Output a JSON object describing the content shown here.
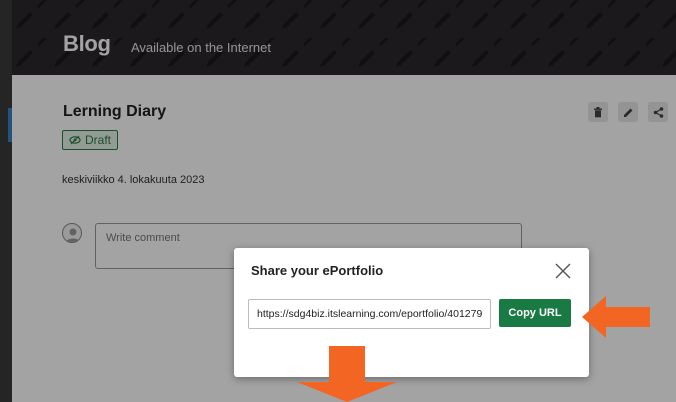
{
  "header": {
    "title": "Blog",
    "subtitle": "Available on the Internet"
  },
  "post": {
    "title": "Lerning Diary",
    "status": "Draft",
    "date": "keskiviikko 4. lokakuuta 2023"
  },
  "toolbar": {
    "icons": [
      "trash-icon",
      "pencil-icon",
      "share-icon"
    ]
  },
  "comment": {
    "placeholder": "Write comment"
  },
  "modal": {
    "title": "Share your ePortfolio",
    "url": "https://sdg4biz.itslearning.com/eportfolio/401279",
    "copy_label": "Copy URL"
  },
  "colors": {
    "header_bg": "#2c282d",
    "accent_green": "#1a7a43",
    "arrow_orange": "#f26522"
  }
}
